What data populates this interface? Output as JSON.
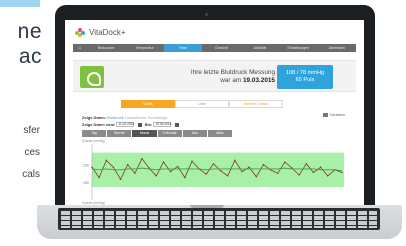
{
  "background_text": {
    "big_line_1": "ne",
    "big_line_2": "ac",
    "small_line_1": "sfer",
    "small_line_2": "ces",
    "small_line_3": "cals"
  },
  "app": {
    "logo_text": "VitaDock+",
    "nav": [
      "Blutzucker",
      "Temperatur",
      "Herz",
      "Gewicht",
      "Aktivität",
      "Einstellungen",
      "Abmelden"
    ],
    "nav_active_index": 2,
    "home_glyph": "⌂",
    "banner": {
      "text_line_1": "Ihre letzte Blutdruck Messung",
      "text_line_2_prefix": "war am",
      "text_line_2_date": "19.03.2015",
      "value_line_1": "108 / 78 mmHg",
      "value_line_2": "65 Puls"
    },
    "tabs": [
      "Grafik",
      "Liste",
      "Weitere Details"
    ],
    "tabs_active_index": 0,
    "print_label": "Drucken",
    "show_data": {
      "label": "Zeige Daten:",
      "option_1": "Blutdruck",
      "option_2": "Diastolische Rechtslage"
    },
    "date_range": {
      "from_label": "Zeige Daten vom:",
      "from_value": "11.02.2015",
      "to_label": "Bis:",
      "to_value": "19.03.2015"
    },
    "ranges": [
      "Tag",
      "Woche",
      "Monat",
      "3 Monate",
      "Jahr",
      "Alles"
    ],
    "ranges_active_index": 2,
    "axis_top_label": "Systole (mmHg)",
    "axis_bottom_label": "Systole (mmHg)"
  },
  "chart_data": {
    "type": "line",
    "ylim": [
      80,
      145
    ],
    "band": [
      95,
      135
    ],
    "ticks": [
      120,
      100
    ],
    "series": [
      {
        "values": [
          118,
          106,
          126,
          118,
          104,
          121,
          111,
          128,
          117,
          108,
          124,
          113,
          119,
          106,
          125,
          116,
          110,
          122,
          114,
          108,
          126,
          113,
          118,
          107,
          121,
          115,
          111,
          124,
          117,
          109,
          122,
          112,
          118,
          108,
          115,
          112
        ],
        "color": "#7a3b2a"
      },
      {
        "values": [
          116,
          115,
          116,
          115,
          115,
          116,
          116,
          117,
          116,
          115,
          116,
          116,
          116,
          116,
          116,
          116,
          115,
          116,
          116,
          116,
          116,
          116,
          116,
          116,
          116,
          116,
          116,
          117,
          116,
          116,
          116,
          116,
          115,
          115,
          115,
          114
        ],
        "color": "#4a9a4a"
      }
    ],
    "band_color": "#a8efa8"
  }
}
